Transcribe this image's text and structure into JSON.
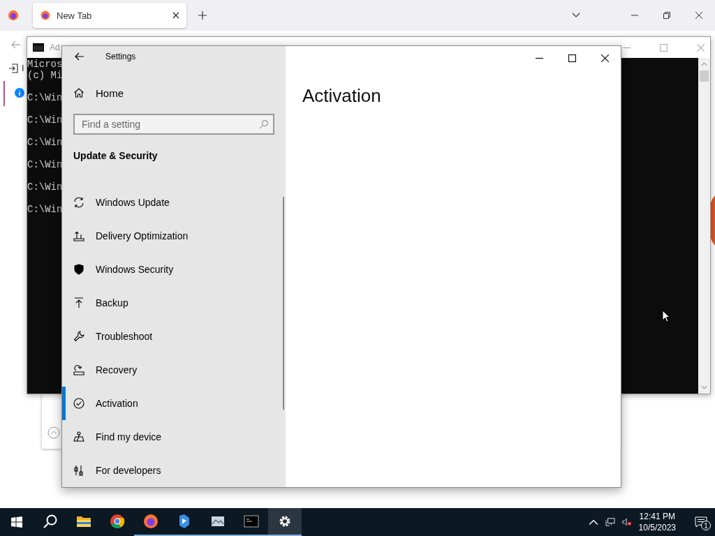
{
  "browser": {
    "tabs": [
      {
        "label": "New Tab",
        "selected": true
      }
    ],
    "side_text": "I"
  },
  "console": {
    "title": "Ad",
    "header": [
      "Micros",
      "(c) Mi"
    ],
    "prompts": [
      "C:\\Win",
      "C:\\Win",
      "C:\\Win",
      "C:\\Win",
      "C:\\Win",
      "C:\\Win"
    ]
  },
  "settings": {
    "title": "Settings",
    "home": "Home",
    "search": {
      "placeholder": "Find a setting"
    },
    "section": "Update & Security",
    "page_title": "Activation",
    "items": [
      {
        "label": "Windows Update",
        "kind": "update",
        "selected": false
      },
      {
        "label": "Delivery Optimization",
        "kind": "delivery",
        "selected": false
      },
      {
        "label": "Windows Security",
        "kind": "shield",
        "selected": false
      },
      {
        "label": "Backup",
        "kind": "backup",
        "selected": false
      },
      {
        "label": "Troubleshoot",
        "kind": "wrench",
        "selected": false
      },
      {
        "label": "Recovery",
        "kind": "recovery",
        "selected": false
      },
      {
        "label": "Activation",
        "kind": "check",
        "selected": true
      },
      {
        "label": "Find my device",
        "kind": "find",
        "selected": false
      },
      {
        "label": "For developers",
        "kind": "dev",
        "selected": false
      }
    ]
  },
  "taskbar": {
    "apps": [
      {
        "kind": "search",
        "open": false,
        "selected": false
      },
      {
        "kind": "folder",
        "open": false,
        "selected": false
      },
      {
        "kind": "chrome",
        "open": false,
        "selected": false
      },
      {
        "kind": "firefox",
        "open": true,
        "selected": false
      },
      {
        "kind": "bing",
        "open": true,
        "selected": false
      },
      {
        "kind": "photos",
        "open": true,
        "selected": false
      },
      {
        "kind": "console",
        "open": true,
        "selected": false
      },
      {
        "kind": "gear",
        "open": true,
        "selected": true
      }
    ],
    "time": "12:41 PM",
    "date": "10/5/2023",
    "notifications": "1"
  }
}
